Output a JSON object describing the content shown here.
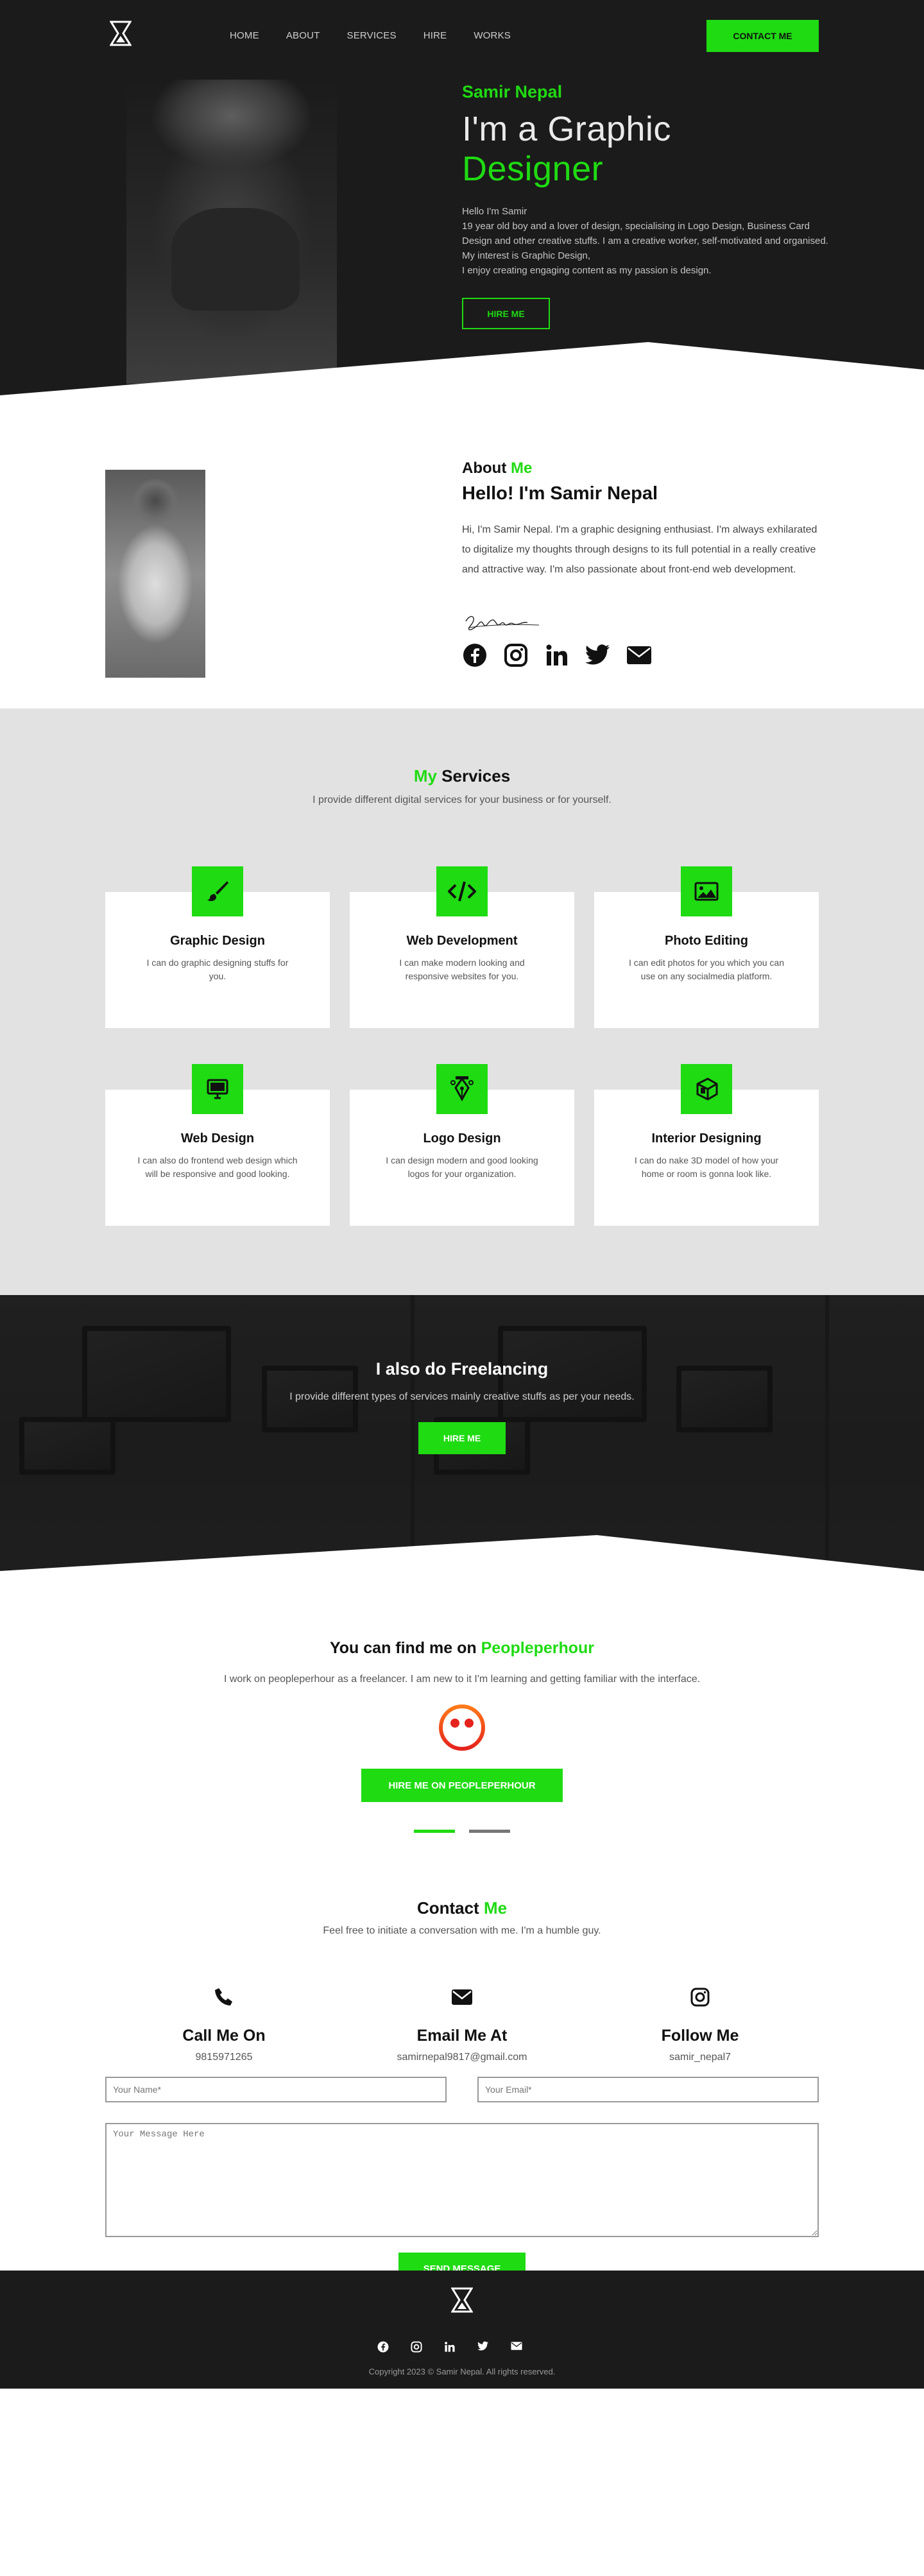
{
  "nav": {
    "items": [
      "HOME",
      "ABOUT",
      "SERVICES",
      "HIRE",
      "WORKS"
    ],
    "contact_label": "CONTACT ME"
  },
  "hero": {
    "name": "Samir Nepal",
    "title_line1": "I'm a Graphic",
    "title_line2": "Designer",
    "desc": [
      "Hello I'm Samir",
      "19 year old boy and a lover of design, specialising in Logo Design, Business Card Design and other creative stuffs. I am a creative worker, self-motivated and organised. My interest is Graphic Design,",
      "I enjoy creating engaging content as my passion is design."
    ],
    "hire_label": "HIRE ME"
  },
  "about": {
    "heading_a": "About ",
    "heading_b": "Me",
    "sub": "Hello! I'm Samir Nepal",
    "text": "Hi, I'm Samir Nepal. I'm a graphic designing enthusiast. I'm always exhilarated to digitalize my thoughts through designs to its full potential in a really creative and attractive way. I'm also passionate about front-end web development.",
    "social_icons": [
      "facebook-icon",
      "instagram-icon",
      "linkedin-icon",
      "twitter-icon",
      "envelope-icon"
    ]
  },
  "services": {
    "title_a": "My",
    "title_b": " Services",
    "sub": "I provide different digital services for your business or for yourself.",
    "cards": [
      {
        "icon": "brush-icon",
        "title": "Graphic Design",
        "desc": "I can do graphic designing stuffs for you."
      },
      {
        "icon": "code-icon",
        "title": "Web Development",
        "desc": "I can make modern looking and responsive websites for you."
      },
      {
        "icon": "image-icon",
        "title": "Photo Editing",
        "desc": "I can edit photos for you which you can use on any socialmedia platform."
      },
      {
        "icon": "monitor-icon",
        "title": "Web Design",
        "desc": "I can also do frontend web design which will be responsive and good looking."
      },
      {
        "icon": "pen-nib-icon",
        "title": "Logo Design",
        "desc": "I can design modern and good looking logos for your organization."
      },
      {
        "icon": "cube-icon",
        "title": "Interior Designing",
        "desc": "I can do nake 3D model of how your home or room is gonna look like."
      }
    ]
  },
  "freelance": {
    "title": "I also do Freelancing",
    "sub": "I provide different types of services mainly creative stuffs as per your needs.",
    "hire_label": "HIRE ME"
  },
  "pph": {
    "title_a": "You can find me on ",
    "title_b": "Peopleperhour",
    "sub": "I work on peopleperhour as a freelancer. I am new to it I'm learning and getting familiar with the interface.",
    "button": "HIRE ME ON PEOPLEPERHOUR"
  },
  "contact": {
    "title_a": "Contact ",
    "title_b": "Me",
    "sub": "Feel free to initiate a conversation with me. I'm a humble guy.",
    "items": [
      {
        "icon": "phone-icon",
        "title": "Call Me On",
        "value": "9815971265"
      },
      {
        "icon": "envelope-icon",
        "title": "Email Me At",
        "value": "samirnepal9817@gmail.com"
      },
      {
        "icon": "instagram-icon",
        "title": "Follow Me",
        "value": "samir_nepal7"
      }
    ],
    "name_placeholder": "Your Name*",
    "email_placeholder": "Your Email*",
    "message_placeholder": "Your Message Here",
    "send_label": "SEND MESSAGE"
  },
  "footer": {
    "copyright": "Copyright 2023 © Samir Nepal. All rights reserved.",
    "social_icons": [
      "facebook-icon",
      "instagram-icon",
      "linkedin-icon",
      "twitter-icon",
      "envelope-icon"
    ]
  },
  "colors": {
    "accent": "#1fdb12",
    "dark": "#1b1b1b",
    "light": "#e2e2e2"
  }
}
